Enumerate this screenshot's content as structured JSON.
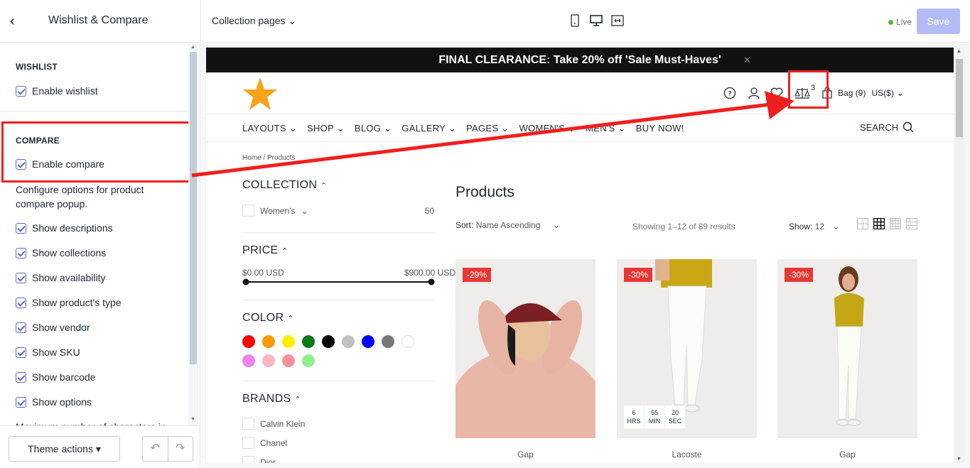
{
  "topbar": {
    "title": "Wishlist & Compare",
    "page_selector": "Collection pages",
    "live_label": "Live",
    "save_label": "Save"
  },
  "sidebar": {
    "wishlist_title": "WISHLIST",
    "enable_wishlist": "Enable wishlist",
    "compare_title": "COMPARE",
    "enable_compare": "Enable compare",
    "compare_help": "Configure options for product compare popup.",
    "options": [
      "Show descriptions",
      "Show collections",
      "Show availability",
      "Show product's type",
      "Show vendor",
      "Show SKU",
      "Show barcode",
      "Show options"
    ],
    "max_chars_label": "Maximum number of characters in",
    "theme_actions": "Theme actions"
  },
  "preview": {
    "announcement": "FINAL CLEARANCE: Take 20% off 'Sale Must-Haves'",
    "compare_count": "3",
    "bag": "Bag (9)",
    "currency": "US($)",
    "nav": [
      "LAYOUTS",
      "SHOP",
      "BLOG",
      "GALLERY",
      "PAGES",
      "WOMEN'S",
      "MEN'S",
      "BUY NOW!"
    ],
    "search": "SEARCH",
    "breadcrumb": "Home  /  Products",
    "filters": {
      "collection_title": "COLLECTION",
      "collection_item": "Women's",
      "collection_count": "50",
      "price_title": "PRICE",
      "price_min": "$0.00 USD",
      "price_max": "$900.00 USD",
      "color_title": "COLOR",
      "colors": [
        "#ff0000",
        "#ff9800",
        "#ffee00",
        "#0a7a17",
        "#000000",
        "#c0c0c0",
        "#0000ff",
        "#777777",
        "#ffffff",
        "#ee82ee",
        "#ffb6c1",
        "#f88fa0",
        "#90ee90"
      ],
      "brands_title": "BRANDS",
      "brands": [
        "Calvin Klein",
        "Chanel",
        "Dior"
      ]
    },
    "products_title": "Products",
    "sort_label": "Sort:",
    "sort_value": "Name Ascending",
    "showing": "Showing 1–12 of 89 results",
    "show_label": "Show:",
    "show_value": "12",
    "products": [
      {
        "badge": "-29%",
        "name": "Gap"
      },
      {
        "badge": "-30%",
        "name": "Lacoste"
      },
      {
        "badge": "-30%",
        "name": "Gap"
      }
    ],
    "timer": [
      {
        "value": "6",
        "unit": "HRS"
      },
      {
        "value": "55",
        "unit": "MIN"
      },
      {
        "value": "20",
        "unit": "SEC"
      }
    ]
  },
  "colors": {
    "accent": "#5c6ac4",
    "highlight": "#f01f1f",
    "badge": "#e53935"
  }
}
